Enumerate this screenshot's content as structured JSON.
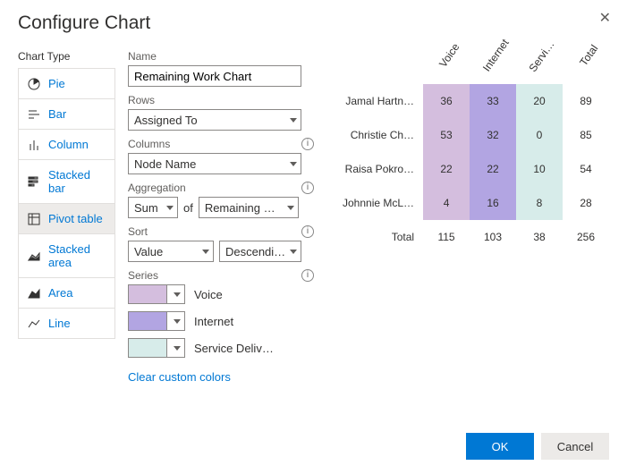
{
  "title": "Configure Chart",
  "chartTypeLabel": "Chart Type",
  "chartTypes": [
    {
      "id": "pie",
      "label": "Pie"
    },
    {
      "id": "bar",
      "label": "Bar"
    },
    {
      "id": "column",
      "label": "Column"
    },
    {
      "id": "stacked-bar",
      "label": "Stacked bar"
    },
    {
      "id": "pivot-table",
      "label": "Pivot table"
    },
    {
      "id": "stacked-area",
      "label": "Stacked area"
    },
    {
      "id": "area",
      "label": "Area"
    },
    {
      "id": "line",
      "label": "Line"
    }
  ],
  "labels": {
    "name": "Name",
    "rows": "Rows",
    "columns": "Columns",
    "aggregation": "Aggregation",
    "of": "of",
    "sort": "Sort",
    "series": "Series"
  },
  "values": {
    "name": "Remaining Work Chart",
    "rows": "Assigned To",
    "columns": "Node Name",
    "aggFn": "Sum",
    "aggField": "Remaining Work",
    "sortBy": "Value",
    "sortDir": "Descending"
  },
  "series": [
    {
      "label": "Voice",
      "color": "#d4bede"
    },
    {
      "label": "Internet",
      "color": "#b2a5e2"
    },
    {
      "label": "Service Deliv…",
      "color": "#d7ecea"
    }
  ],
  "clearColors": "Clear custom colors",
  "buttons": {
    "ok": "OK",
    "cancel": "Cancel"
  },
  "chart_data": {
    "type": "table",
    "columns": [
      "Voice",
      "Internet",
      "Service Del…",
      "Total"
    ],
    "rows": [
      {
        "label": "Jamal Hartn…",
        "cells": [
          36,
          33,
          20,
          89
        ]
      },
      {
        "label": "Christie Ch…",
        "cells": [
          53,
          32,
          0,
          85
        ]
      },
      {
        "label": "Raisa Pokro…",
        "cells": [
          22,
          22,
          10,
          54
        ]
      },
      {
        "label": "Johnnie McL…",
        "cells": [
          4,
          16,
          8,
          28
        ]
      }
    ],
    "totalLabel": "Total",
    "totals": [
      115,
      103,
      38,
      256
    ]
  }
}
